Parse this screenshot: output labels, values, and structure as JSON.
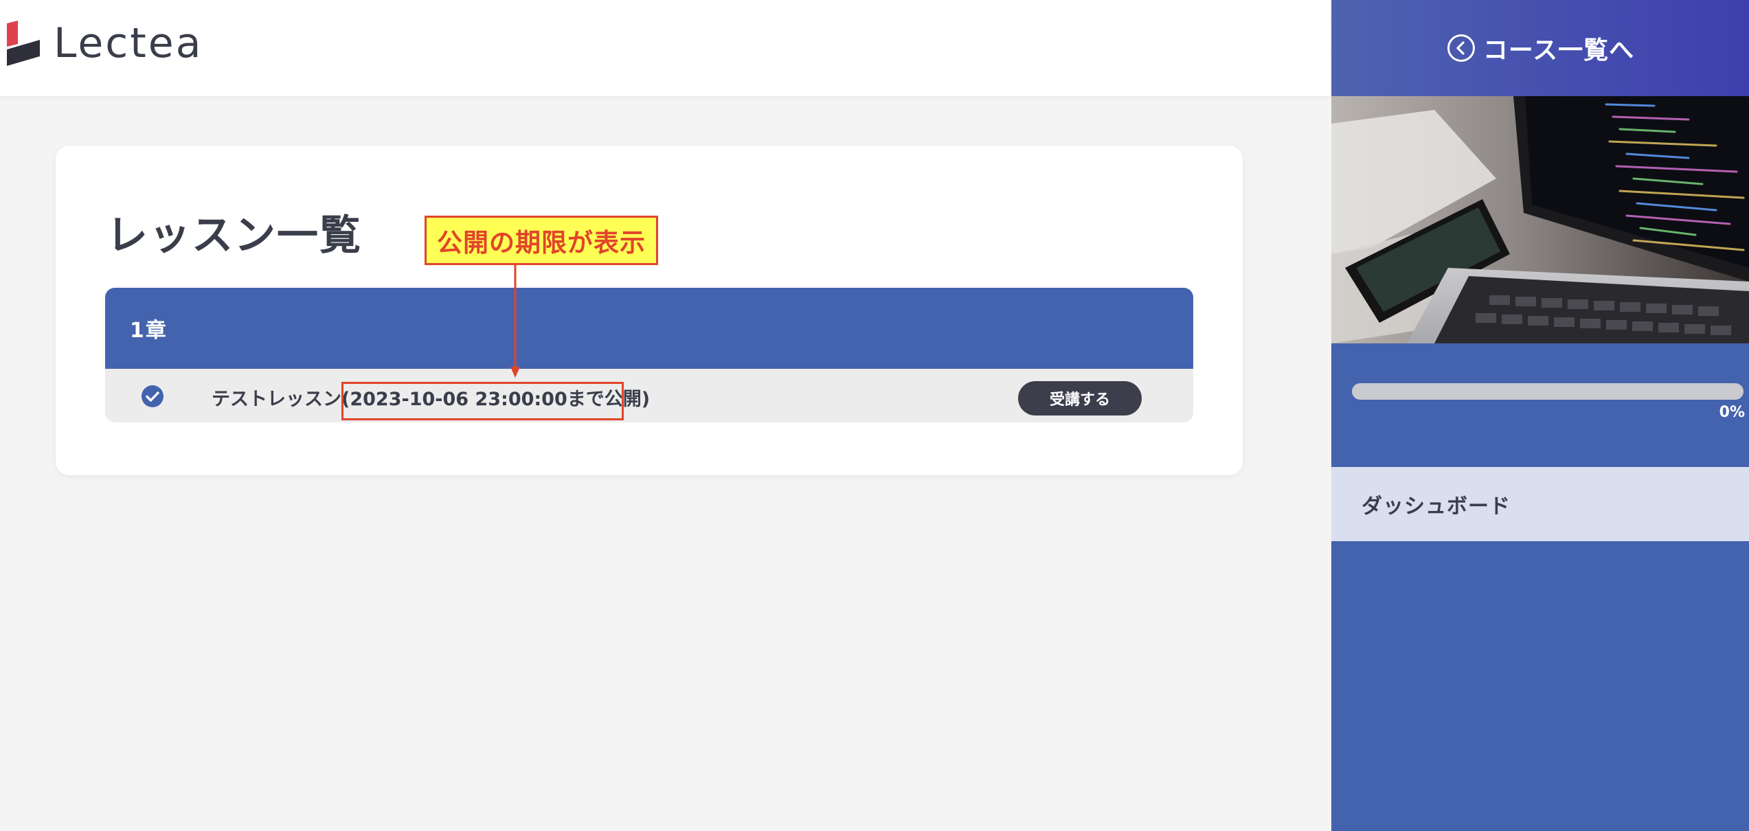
{
  "header": {
    "logo_text": "Lectea"
  },
  "main": {
    "title": "レッスン一覧",
    "chapters": [
      {
        "title": "1章",
        "lessons": [
          {
            "name": "テストレッスン",
            "availability": "(2023-10-06 23:00:00まで公開)",
            "completed": true,
            "button_label": "受講する"
          }
        ]
      }
    ]
  },
  "annotation": {
    "callout_text": "公開の期限が表示"
  },
  "sidebar": {
    "back_label": "コース一覧へ",
    "progress_percent": 0,
    "progress_label": "0%",
    "nav_items": [
      {
        "label": "ダッシュボード"
      }
    ]
  },
  "colors": {
    "primary": "#4463ae",
    "dark_button": "#3d3e4c",
    "annotation_red": "#e0452a",
    "annotation_yellow": "#ffff55",
    "text_dark": "#3a3d4a"
  }
}
